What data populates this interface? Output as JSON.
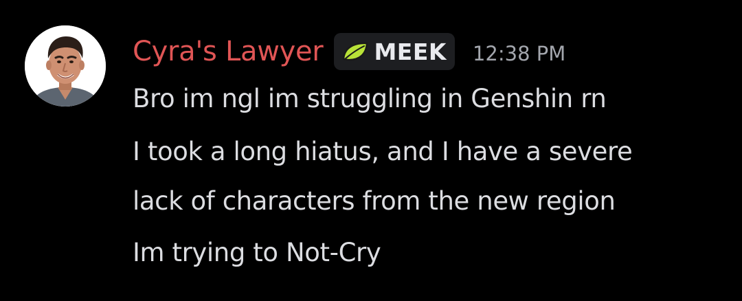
{
  "message": {
    "author": "Cyra's Lawyer",
    "author_color": "#e05555",
    "tag": {
      "icon": "leaf-icon",
      "label": "MEEK"
    },
    "timestamp": "12:38 PM",
    "lines": [
      "Bro im ngl im struggling in Genshin rn",
      "I took a long hiatus, and I have a severe",
      "lack of characters from the new region",
      "Im trying to Not-Cry"
    ]
  }
}
